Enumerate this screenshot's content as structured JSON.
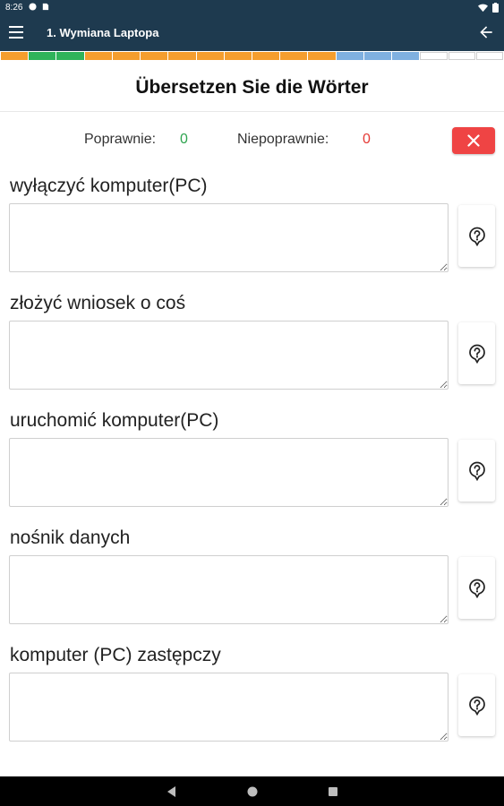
{
  "status_bar": {
    "time": "8:26"
  },
  "app_bar": {
    "title": "1. Wymiana Laptopa"
  },
  "progress": {
    "segments": [
      "orange",
      "green",
      "green",
      "orange",
      "orange",
      "orange",
      "orange",
      "orange",
      "orange",
      "orange",
      "orange",
      "orange",
      "blue",
      "blue",
      "blue",
      "white",
      "white",
      "white"
    ],
    "colors": {
      "orange": "#f59e2e",
      "green": "#2fb35a",
      "blue": "#7fb0e0",
      "white": "#ffffff"
    }
  },
  "heading": "Übersetzen Sie die Wörter",
  "score": {
    "correct_label": "Poprawnie:",
    "correct_value": "0",
    "incorrect_label": "Niepoprawnie:",
    "incorrect_value": "0"
  },
  "items": [
    {
      "prompt": "wyłączyć komputer(PC)",
      "answer": ""
    },
    {
      "prompt": "złożyć wniosek o coś",
      "answer": ""
    },
    {
      "prompt": "uruchomić komputer(PC)",
      "answer": ""
    },
    {
      "prompt": "nośnik danych",
      "answer": ""
    },
    {
      "prompt": "komputer (PC) zastępczy",
      "answer": ""
    }
  ],
  "icons": {
    "menu": "menu-icon",
    "back": "arrow-left-icon",
    "close": "close-icon",
    "hint": "question-bubble-icon"
  }
}
